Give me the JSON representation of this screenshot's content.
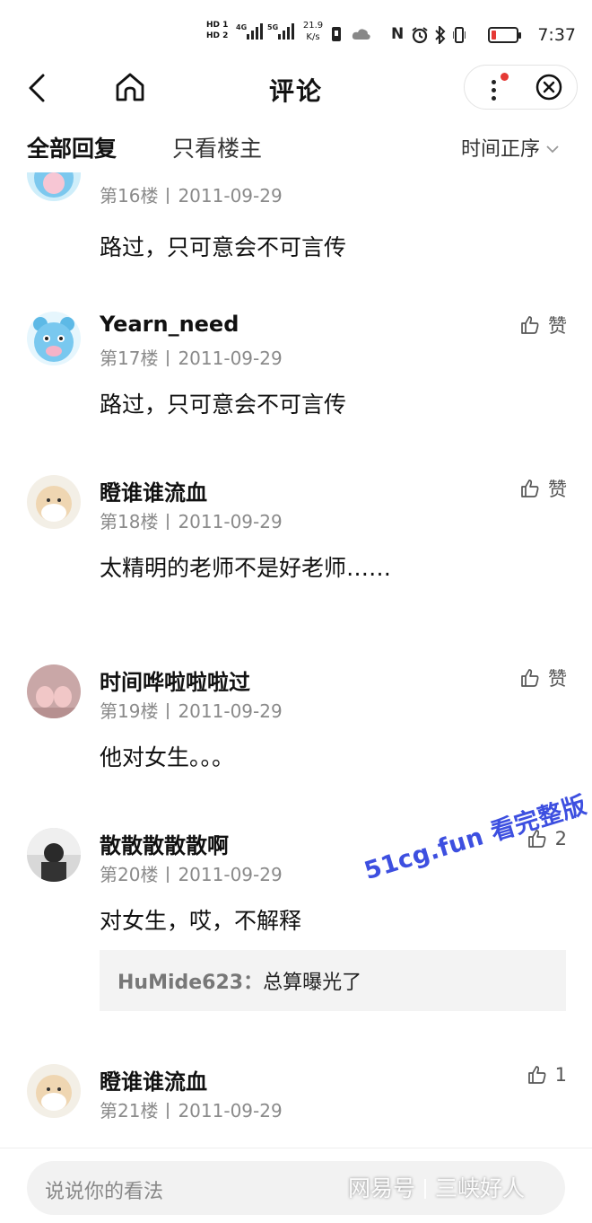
{
  "status_bar": {
    "hd1": "HD 1",
    "hd2": "HD 2",
    "net1": "4G",
    "net2": "5G",
    "speed": "21.9",
    "speed_unit": "K/s",
    "nfc": "N",
    "time": "7:37"
  },
  "header": {
    "title": "评论"
  },
  "filters": {
    "all": "全部回复",
    "op_only": "只看楼主",
    "sort": "时间正序"
  },
  "comments": [
    {
      "user": "",
      "floor": "第16楼",
      "date": "2011-09-29",
      "text": "路过，只可意会不可言传",
      "like": ""
    },
    {
      "user": "Yearn_need",
      "floor": "第17楼",
      "date": "2011-09-29",
      "text": "路过，只可意会不可言传",
      "like": "赞"
    },
    {
      "user": "瞪谁谁流血",
      "floor": "第18楼",
      "date": "2011-09-29",
      "text": "太精明的老师不是好老师……",
      "like": "赞"
    },
    {
      "user": "时间哗啦啦啦过",
      "floor": "第19楼",
      "date": "2011-09-29",
      "text": "他对女生。。。",
      "like": "赞"
    },
    {
      "user": "散散散散散啊",
      "floor": "第20楼",
      "date": "2011-09-29",
      "text": "对女生，哎，不解释",
      "like": "2",
      "reply_user": "HuMide623：",
      "reply_text": "总算曝光了"
    },
    {
      "user": "瞪谁谁流血",
      "floor": "第21楼",
      "date": "2011-09-29",
      "text": "",
      "like": "1"
    }
  ],
  "bottom": {
    "placeholder": "说说你的看法"
  },
  "overlay": {
    "watermark": "51cg.fun 看完整版",
    "source": "网易号",
    "source_name": "三峡好人"
  },
  "colors": {
    "accent_red": "#e53935",
    "watermark_blue": "#3d4fe0",
    "meta_gray": "#8a8a8a"
  }
}
